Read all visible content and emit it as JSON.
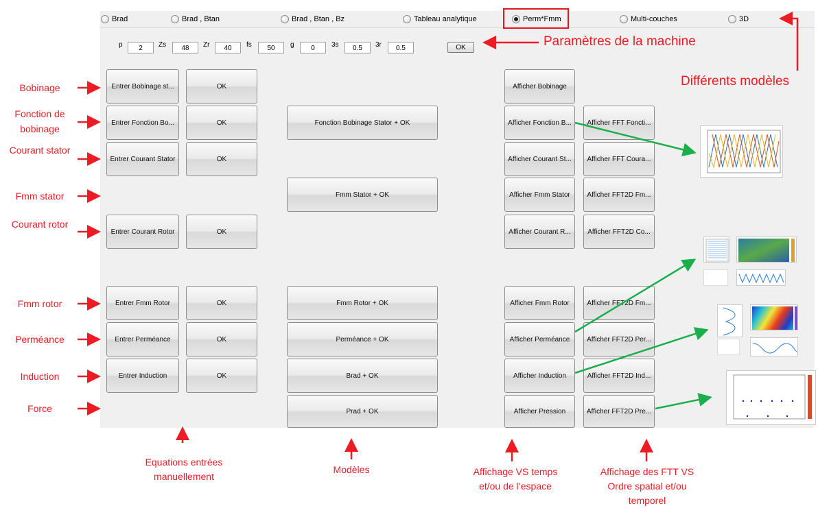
{
  "models": [
    {
      "label": "Brad",
      "selected": false
    },
    {
      "label": "Brad , Btan",
      "selected": false
    },
    {
      "label": "Brad , Btan , Bz",
      "selected": false
    },
    {
      "label": "Tableau analytique",
      "selected": false
    },
    {
      "label": "Perm*Fmm",
      "selected": true
    },
    {
      "label": "Multi-couches",
      "selected": false
    },
    {
      "label": "3D",
      "selected": false
    }
  ],
  "params": [
    {
      "label": "p",
      "value": "2"
    },
    {
      "label": "Zs",
      "value": "48"
    },
    {
      "label": "Zr",
      "value": "40"
    },
    {
      "label": "fs",
      "value": "50"
    },
    {
      "label": "g",
      "value": "0"
    },
    {
      "label": "3s",
      "value": "0.5"
    },
    {
      "label": "3r",
      "value": "0.5"
    }
  ],
  "params_ok": "OK",
  "entry_col": {
    "bobinage": "Entrer Bobinage st...",
    "fonction": "Entrer Fonction Bo...",
    "courant_stator": "Entrer Courant Stator",
    "courant_rotor": "Entrer Courant Rotor",
    "fmm_rotor": "Entrer Fmm Rotor",
    "permeance": "Entrer Perméance",
    "induction": "Entrer Induction"
  },
  "ok_label": "OK",
  "model_col": {
    "fonction": "Fonction Bobinage Stator + OK",
    "fmm_stator": "Fmm Stator + OK",
    "fmm_rotor": "Fmm Rotor + OK",
    "permeance": "Perméance + OK",
    "brad": "Brad + OK",
    "prad": "Prad + OK"
  },
  "display_col": {
    "bobinage": "Afficher Bobinage",
    "fonction": "Afficher Fonction B...",
    "courant_stator": "Afficher Courant St...",
    "fmm_stator": "Afficher Fmm Stator",
    "courant_rotor": "Afficher Courant R...",
    "fmm_rotor": "Afficher Fmm Rotor",
    "permeance": "Afficher Perméance",
    "induction": "Afficher Induction",
    "pression": "Afficher Pression"
  },
  "fft_col": {
    "fonction": "Afficher FFT Foncti...",
    "courant": "Afficher FFT Coura...",
    "fmm_stator": "Afficher FFT2D Fm...",
    "courant_rotor": "Afficher FFT2D Co...",
    "fmm_rotor": "Afficher FFT2D Fm...",
    "permeance": "Afficher FFT2D Per...",
    "induction": "Afficher FFT2D Ind...",
    "pression": "Afficher FFT2D Pre..."
  },
  "side_labels": {
    "bobinage": "Bobinage",
    "fonction": "Fonction de bobinage",
    "courant_stator": "Courant stator",
    "fmm_stator": "Fmm stator",
    "courant_rotor": "Courant rotor",
    "fmm_rotor": "Fmm rotor",
    "permeance": "Perméance",
    "induction": "Induction",
    "force": "Force"
  },
  "annotations": {
    "parametres": "Paramètres de la machine",
    "modeles_diff": "Différents modèles"
  },
  "bottom_labels": {
    "equations": "Equations entrées manuellement",
    "modeles": "Modèles",
    "affichage": "Affichage VS temps et/ou de l’espace",
    "fft": "Affichage des FTT VS Ordre spatial et/ou temporel"
  },
  "colors": {
    "annotation": "#ed1c24",
    "link_arrow": "#1aaf4b",
    "selected_box": "#e8141b"
  }
}
